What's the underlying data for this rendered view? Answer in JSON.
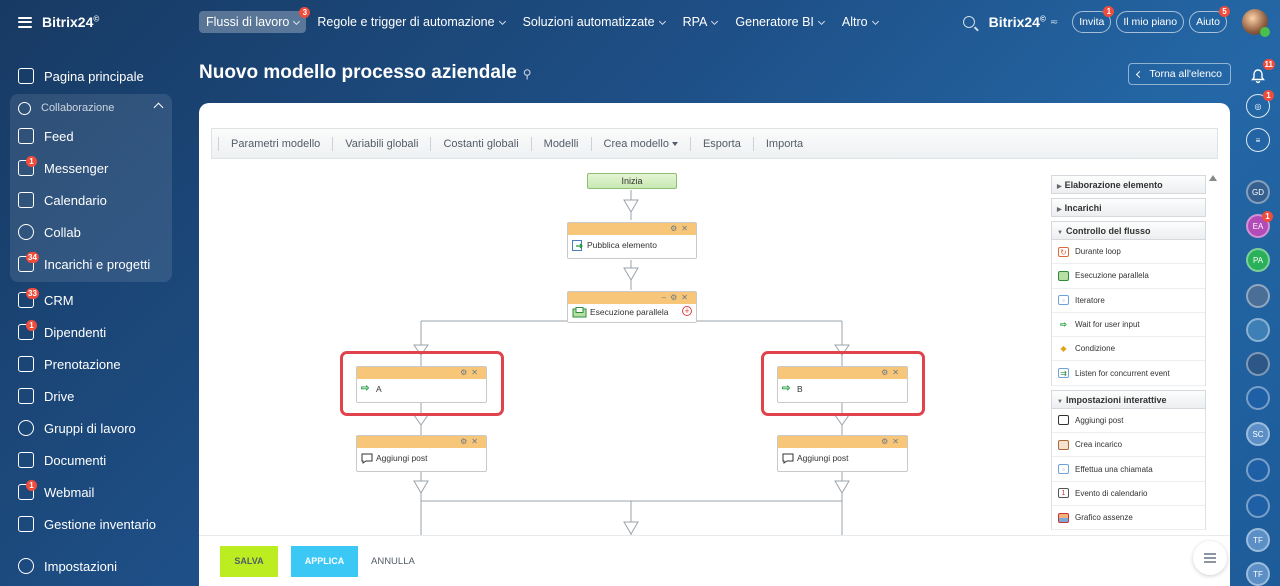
{
  "sidebar": {
    "brand": "Bitrix24",
    "brand_mark": "©",
    "items": [
      {
        "label": "Pagina principale"
      },
      {
        "label": "Collaborazione"
      },
      {
        "label": "Feed"
      },
      {
        "label": "Messenger",
        "badge": "1"
      },
      {
        "label": "Calendario"
      },
      {
        "label": "Collab"
      },
      {
        "label": "Incarichi e progetti",
        "badge": "34"
      },
      {
        "label": "CRM",
        "badge": "33"
      },
      {
        "label": "Dipendenti",
        "badge": "1"
      },
      {
        "label": "Prenotazione"
      },
      {
        "label": "Drive"
      },
      {
        "label": "Gruppi di lavoro"
      },
      {
        "label": "Documenti"
      },
      {
        "label": "Webmail",
        "badge": "1"
      },
      {
        "label": "Gestione inventario"
      },
      {
        "label": "Impostazioni"
      }
    ]
  },
  "topnav": {
    "items": [
      {
        "label": "Flussi di lavoro",
        "badge": "3"
      },
      {
        "label": "Regole e trigger di automazione"
      },
      {
        "label": "Soluzioni automatizzate"
      },
      {
        "label": "RPA"
      },
      {
        "label": "Generatore BI"
      },
      {
        "label": "Altro"
      }
    ],
    "brand": "Bitrix24",
    "brand_mark": "©",
    "invite": {
      "label": "Invita",
      "badge": "1"
    },
    "plan": "Il mio piano",
    "help": {
      "label": "Aiuto",
      "badge": "5"
    }
  },
  "rail": {
    "notifications_badge": "11",
    "feed_badge": "1",
    "avatars": [
      "GD",
      "EA",
      "PA",
      "",
      "",
      "",
      "",
      "SC",
      "",
      "",
      "TF",
      "TF"
    ],
    "ea_badge": "1"
  },
  "page": {
    "title": "Nuovo modello processo aziendale",
    "back_label": "Torna all'elenco"
  },
  "toolbar": {
    "items": [
      "Parametri modello",
      "Variabili globali",
      "Costanti globali",
      "Modelli",
      "Crea modello",
      "Esporta",
      "Importa"
    ]
  },
  "designer": {
    "start": "Inizia",
    "publish": "Pubblica elemento",
    "parallel": "Esecuzione parallela",
    "branch_a": "A",
    "branch_b": "B",
    "post_a": "Aggiungi post",
    "post_b": "Aggiungi post"
  },
  "palette": {
    "sections": [
      {
        "title": "Elaborazione elemento",
        "expanded": false
      },
      {
        "title": "Incarichi",
        "expanded": false
      },
      {
        "title": "Controllo del flusso",
        "expanded": true,
        "items": [
          "Durante loop",
          "Esecuzione parallela",
          "Iteratore",
          "Wait for user input",
          "Condizione",
          "Listen for concurrent event"
        ]
      },
      {
        "title": "Impostazioni interattive",
        "expanded": true,
        "items": [
          "Aggiungi post",
          "Crea incarico",
          "Effettua una chiamata",
          "Evento di calendario",
          "Grafico assenze"
        ]
      }
    ]
  },
  "footer": {
    "save": "SALVA",
    "apply": "APPLICA",
    "cancel": "ANNULLA"
  },
  "colors": {
    "accent_green": "#bbed21",
    "accent_blue": "#3bc8f5",
    "activity_header": "#f7c678",
    "highlight_red": "#e0434b",
    "badge_red": "#f04c3b"
  }
}
